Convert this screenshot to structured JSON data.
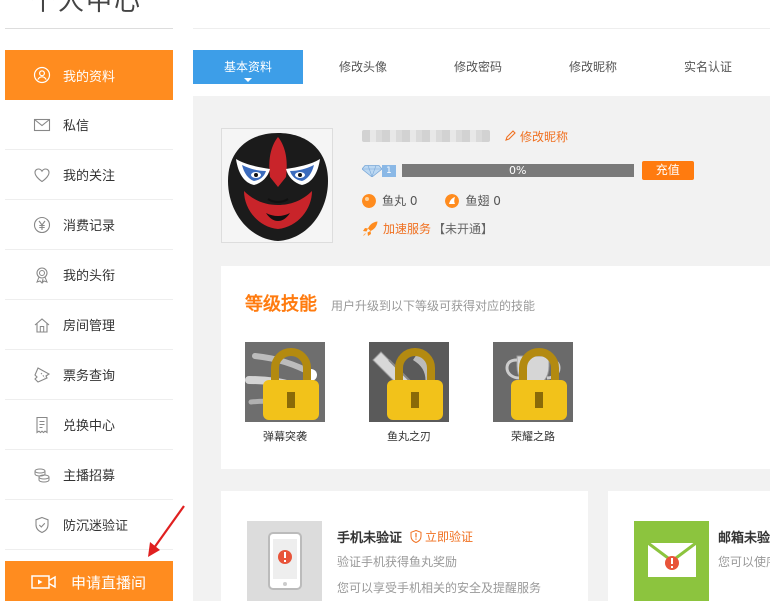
{
  "page": {
    "title": "个人中心"
  },
  "sidebar": {
    "items": [
      {
        "label": "我的资料",
        "icon": "user-icon",
        "active": true
      },
      {
        "label": "私信",
        "icon": "mail-icon",
        "active": false
      },
      {
        "label": "我的关注",
        "icon": "heart-icon",
        "active": false
      },
      {
        "label": "消费记录",
        "icon": "yuan-icon",
        "active": false
      },
      {
        "label": "我的头衔",
        "icon": "badge-icon",
        "active": false
      },
      {
        "label": "房间管理",
        "icon": "house-icon",
        "active": false
      },
      {
        "label": "票务查询",
        "icon": "ticket-icon",
        "active": false
      },
      {
        "label": "兑换中心",
        "icon": "receipt-icon",
        "active": false
      },
      {
        "label": "主播招募",
        "icon": "coins-icon",
        "active": false
      },
      {
        "label": "防沉迷验证",
        "icon": "shield-icon",
        "active": false
      }
    ],
    "live_button": {
      "label": "申请直播间",
      "icon": "video-camera-icon"
    }
  },
  "tabs": [
    {
      "label": "基本资料",
      "active": true
    },
    {
      "label": "修改头像",
      "active": false
    },
    {
      "label": "修改密码",
      "active": false
    },
    {
      "label": "修改昵称",
      "active": false
    },
    {
      "label": "实名认证",
      "active": false
    }
  ],
  "profile": {
    "edit_nickname_label": "修改昵称",
    "level": "1",
    "progress_text": "0%",
    "progress_fraction": 0,
    "recharge_label": "充值",
    "fish_ball": "鱼丸 0",
    "fish_fin": "鱼翅 0",
    "speed_service_link": "加速服务",
    "speed_service_status": "【未开通】"
  },
  "skills": {
    "title": "等级技能",
    "subtitle": "用户升级到以下等级可获得对应的技能",
    "items": [
      {
        "name": "弹幕突袭",
        "locked": true
      },
      {
        "name": "鱼丸之刃",
        "locked": true
      },
      {
        "name": "荣耀之路",
        "locked": true
      }
    ]
  },
  "verify": {
    "phone": {
      "title": "手机未验证",
      "action": "立即验证",
      "line1": "验证手机获得鱼丸奖励",
      "line2": "您可以享受手机相关的安全及提醒服务"
    },
    "email": {
      "title": "邮箱未验",
      "line1": "您可以使序"
    }
  },
  "colors": {
    "accent": "#ff8c1f",
    "tab_active": "#3d9ee8",
    "link": "#f07020"
  }
}
